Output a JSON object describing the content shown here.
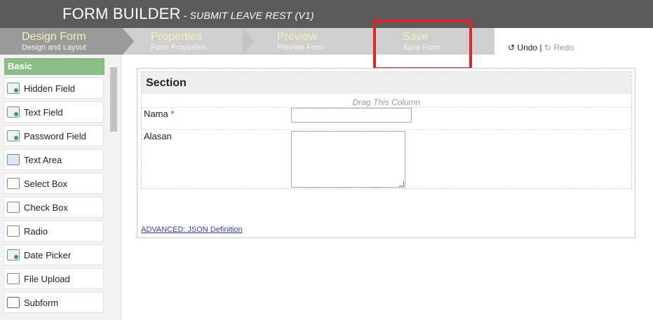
{
  "header": {
    "title": "FORM BUILDER",
    "subtitle": "- SUBMIT LEAVE REST (V1)"
  },
  "steps": [
    {
      "name": "Design Form",
      "sub": "Design and Layout"
    },
    {
      "name": "Properties",
      "sub": "Form Properties"
    },
    {
      "name": "Preview",
      "sub": "Preview Form"
    },
    {
      "name": "Save",
      "sub": "Save Form"
    }
  ],
  "history": {
    "undo": "Undo",
    "separator": "|",
    "redo": "Redo"
  },
  "sidebar": {
    "header": "Basic",
    "items": [
      {
        "label": "Hidden Field",
        "icon": "hidden-field-icon"
      },
      {
        "label": "Text Field",
        "icon": "text-field-icon"
      },
      {
        "label": "Password Field",
        "icon": "password-field-icon"
      },
      {
        "label": "Text Area",
        "icon": "text-area-icon"
      },
      {
        "label": "Select Box",
        "icon": "select-box-icon"
      },
      {
        "label": "Check Box",
        "icon": "check-box-icon"
      },
      {
        "label": "Radio",
        "icon": "radio-icon"
      },
      {
        "label": "Date Picker",
        "icon": "date-picker-icon"
      },
      {
        "label": "File Upload",
        "icon": "file-upload-icon"
      },
      {
        "label": "Subform",
        "icon": "subform-icon"
      }
    ]
  },
  "form": {
    "section_title": "Section",
    "drag_hint": "Drag This Column",
    "fields": [
      {
        "label": "Nama",
        "required_mark": "*",
        "value": ""
      },
      {
        "label": "Alasan",
        "value": ""
      }
    ],
    "json_link": "ADVANCED: JSON Definition"
  },
  "colors": {
    "header_bg": "#5a5a5a",
    "active_step": "#9a9a9a",
    "inactive_step": "#cfcfcf",
    "step_name": "#f3f2b6",
    "sidebar_header": "#8dbd87",
    "highlight": "#e0242c",
    "link": "#3b3bb3"
  }
}
